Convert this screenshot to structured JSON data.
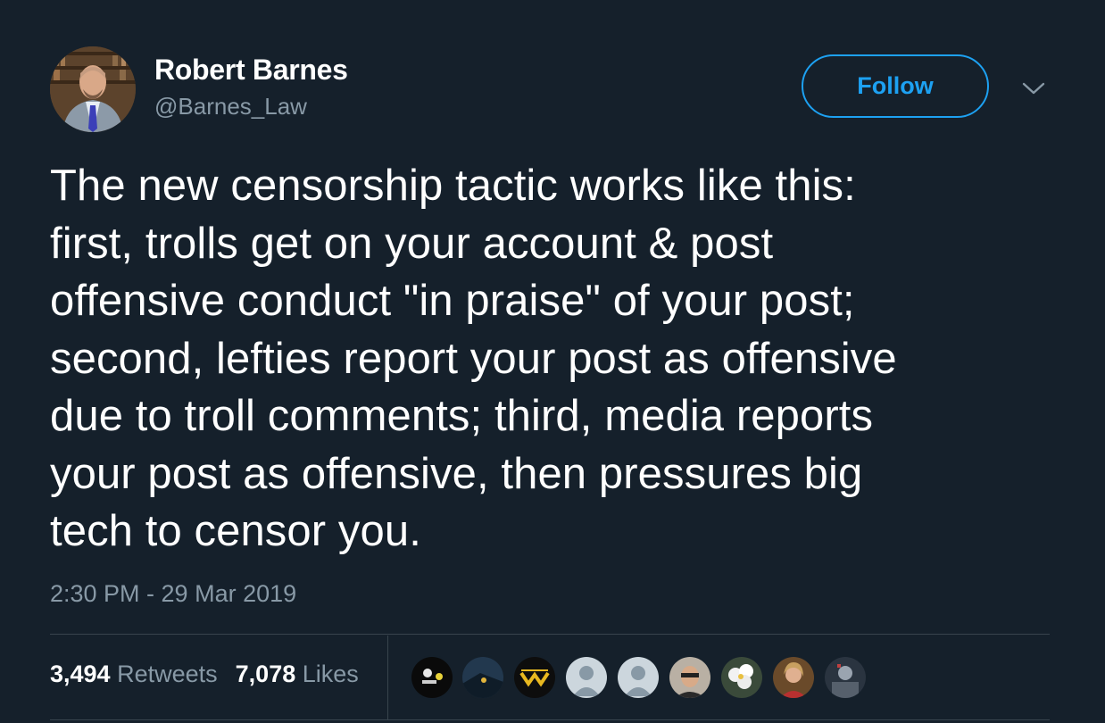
{
  "author": {
    "display_name": "Robert Barnes",
    "handle": "@Barnes_Law"
  },
  "follow_label": "Follow",
  "tweet": {
    "lines": [
      "The new censorship tactic works like this:",
      "first, trolls get on your account & post",
      "offensive conduct \"in praise\" of your post;",
      "second, lefties report your post as offensive",
      "due to troll comments; third, media reports",
      "your post as offensive, then pressures big",
      "tech to censor you."
    ],
    "timestamp": "2:30 PM - 29 Mar 2019"
  },
  "stats": {
    "retweets_count": "3,494",
    "retweets_label": "Retweets",
    "likes_count": "7,078",
    "likes_label": "Likes"
  },
  "likers": [
    "liker-avatar-1",
    "liker-avatar-2",
    "liker-avatar-3",
    "liker-avatar-4",
    "liker-avatar-5",
    "liker-avatar-6",
    "liker-avatar-7",
    "liker-avatar-8",
    "liker-avatar-9"
  ],
  "colors": {
    "background": "#15202b",
    "accent": "#1da1f2",
    "secondary_text": "#8899a6",
    "divider": "#38444d"
  },
  "icons": {
    "more": "chevron-down-icon"
  }
}
